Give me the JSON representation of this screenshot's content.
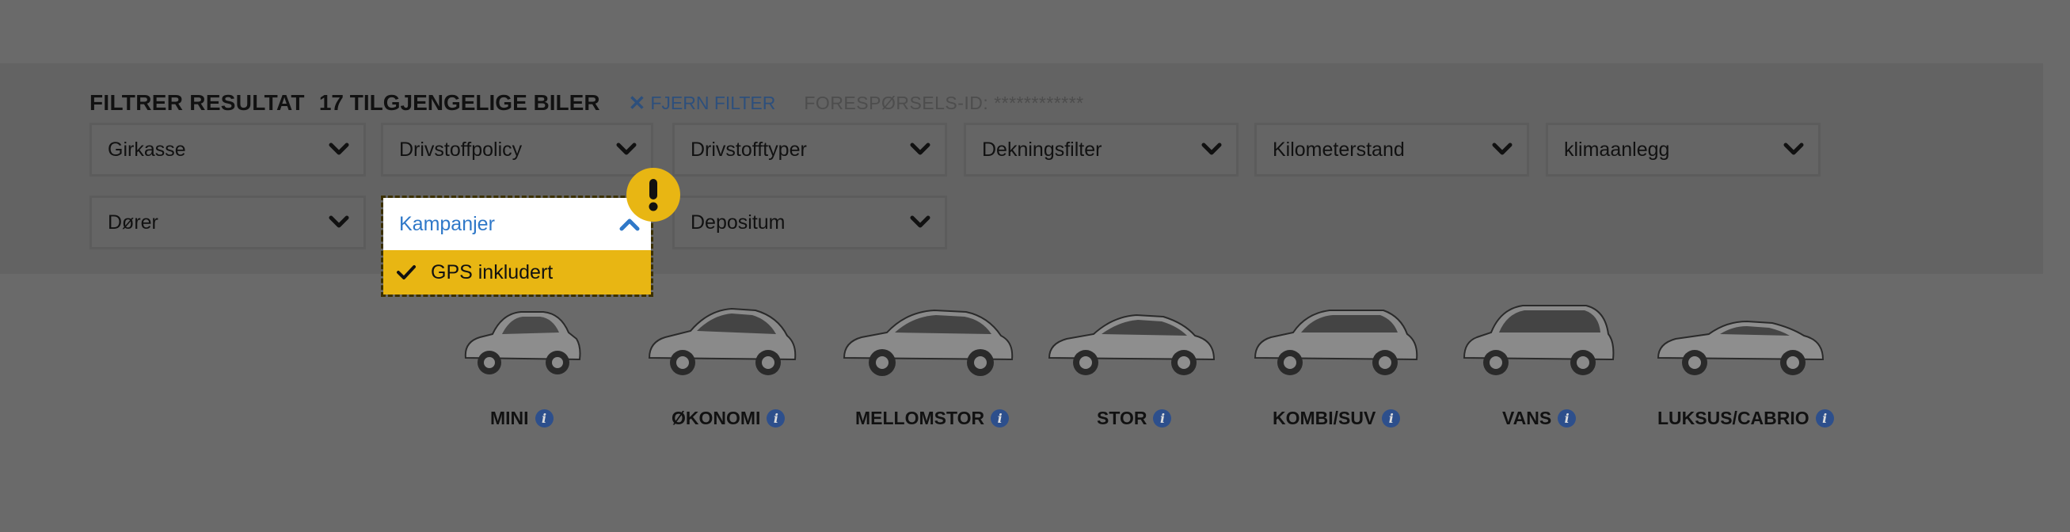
{
  "header": {
    "title": "FILTRER RESULTAT",
    "count": "17 TILGJENGELIGE BILER",
    "clear_icon": "✕",
    "clear_label": "FJERN FILTER",
    "request_id": "FORESPØRSELS-ID: ************"
  },
  "filters": [
    {
      "label": "Girkasse"
    },
    {
      "label": "Drivstoffpolicy"
    },
    {
      "label": "Drivstofftyper"
    },
    {
      "label": "Dekningsfilter"
    },
    {
      "label": "Kilometerstand"
    },
    {
      "label": "klimaanlegg"
    },
    {
      "label": "Dører"
    },
    {
      "label": "Kampanjer"
    },
    {
      "label": "Depositum"
    }
  ],
  "open_dropdown": {
    "label": "Kampanjer",
    "options": [
      {
        "label": "GPS inkludert",
        "checked": true
      }
    ],
    "warning_icon": "exclamation-icon",
    "warning_symbol": "!"
  },
  "categories": [
    {
      "label": "MINI",
      "info": "i"
    },
    {
      "label": "ØKONOMI",
      "info": "i"
    },
    {
      "label": "MELLOMSTOR",
      "info": "i"
    },
    {
      "label": "STOR",
      "info": "i"
    },
    {
      "label": "KOMBI/SUV",
      "info": "i"
    },
    {
      "label": "VANS",
      "info": "i"
    },
    {
      "label": "LUKSUS/CABRIO",
      "info": "i"
    }
  ],
  "colors": {
    "overlay": "#6a6a6a",
    "accent_yellow": "#e8b613",
    "link_blue": "#2f78c8",
    "info_blue": "#2d4f8c"
  }
}
